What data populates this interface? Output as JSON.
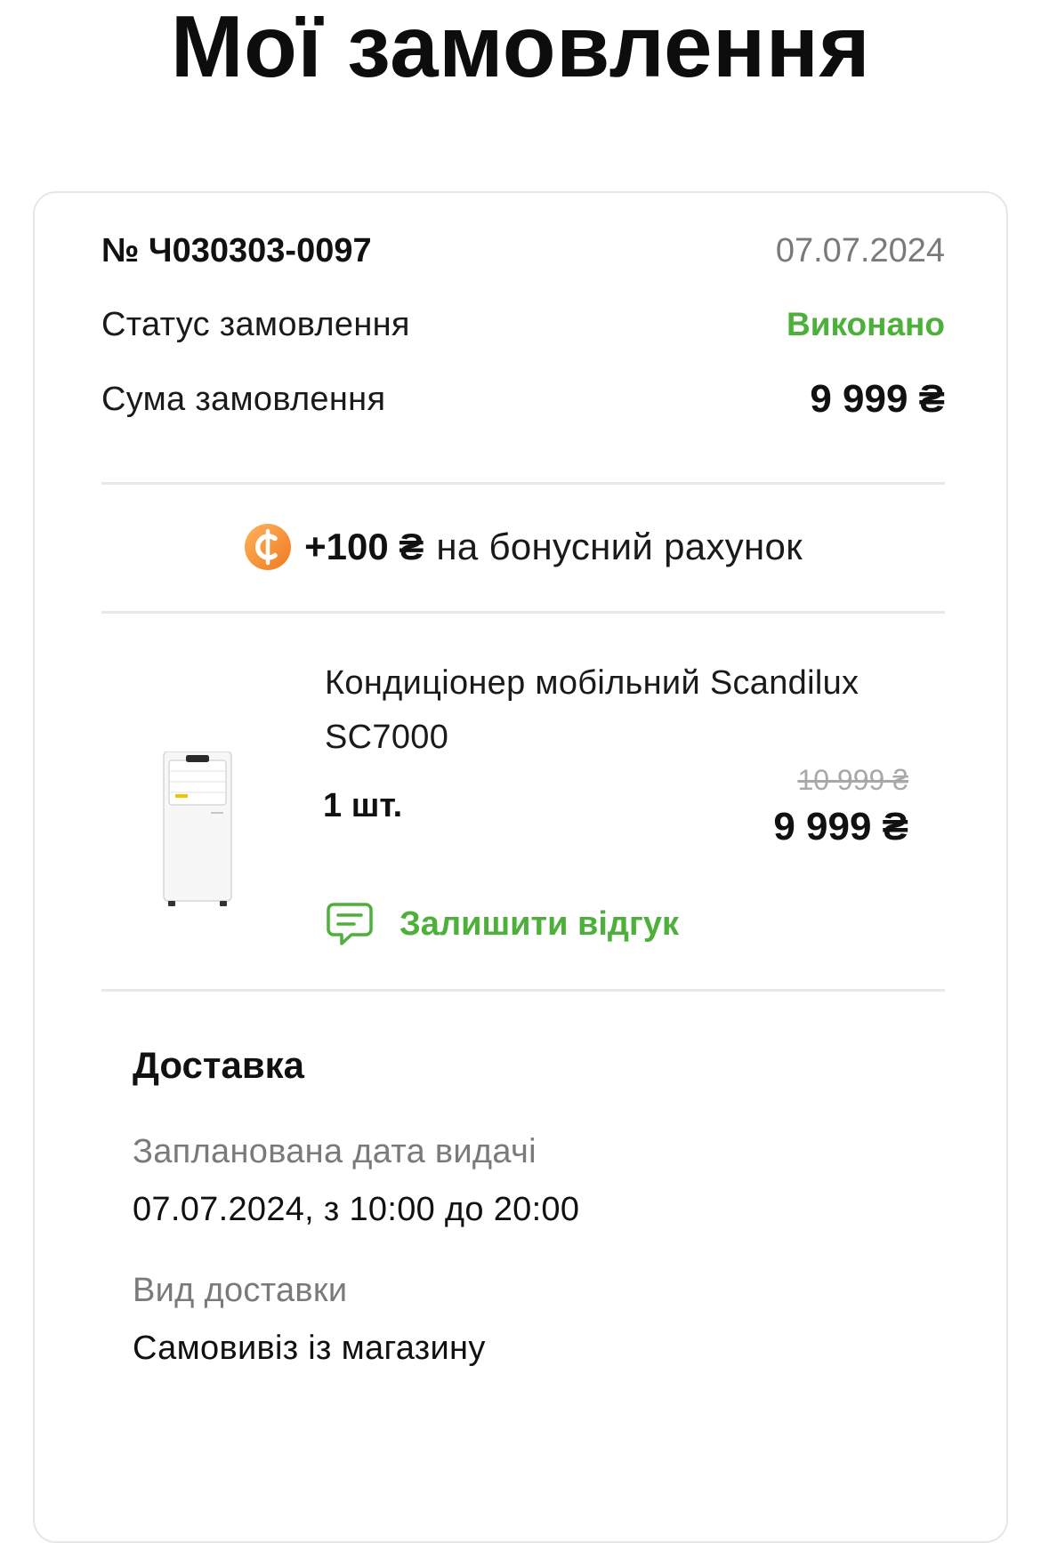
{
  "page": {
    "title": "Мої замовлення"
  },
  "order": {
    "number": "№ Ч030303-0097",
    "date": "07.07.2024",
    "status_label": "Статус замовлення",
    "status_value": "Виконано",
    "sum_label": "Сума замовлення",
    "sum_value": "9 999 ₴"
  },
  "bonus": {
    "icon": "bonus-coin-icon",
    "amount": "+100 ₴",
    "text": "на бонусний рахунок"
  },
  "product": {
    "name": "Кондиціонер мобільний Scandilux SC7000",
    "quantity": "1 шт.",
    "price_old": "10 999 ₴",
    "price_new": "9 999 ₴",
    "review_label": "Залишити відгук",
    "review_icon": "chat-bubble-icon"
  },
  "delivery": {
    "title": "Доставка",
    "planned_label": "Запланована дата видачі",
    "planned_value": "07.07.2024, з 10:00 до 20:00",
    "type_label": "Вид доставки",
    "type_value": "Самовивіз із магазину"
  },
  "colors": {
    "accent_green": "#4db03a",
    "bonus_orange": "#f28a30",
    "muted_text": "#7a7a7a",
    "divider": "#e8e8e8"
  }
}
